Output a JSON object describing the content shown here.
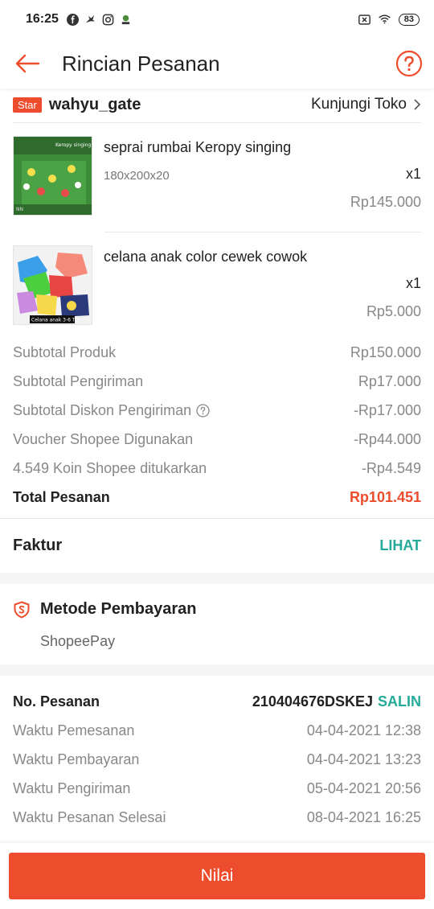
{
  "status_bar": {
    "time": "16:25",
    "battery": "83",
    "icons": [
      "facebook-icon",
      "bird-icon",
      "instagram-icon",
      "app-icon",
      "sim-icon",
      "wifi-icon",
      "battery-icon"
    ]
  },
  "header": {
    "title": "Rincian Pesanan",
    "icons": [
      "back-arrow-icon",
      "help-icon"
    ]
  },
  "shop": {
    "badge": "Star",
    "name": "wahyu_gate",
    "visit_label": "Kunjungi Toko"
  },
  "products": [
    {
      "name": "seprai rumbai Keropy singing",
      "variant": "180x200x20",
      "qty": "x1",
      "price": "Rp145.000",
      "image_text": "Keropy singing",
      "image_watermark": "NN"
    },
    {
      "name": "celana anak color cewek cowok",
      "variant": "",
      "qty": "x1",
      "price": "Rp5.000",
      "image_caption": "Celana anak 3-6 Th"
    }
  ],
  "summary": [
    {
      "label": "Subtotal Produk",
      "value": "Rp150.000"
    },
    {
      "label": "Subtotal Pengiriman",
      "value": "Rp17.000"
    },
    {
      "label": "Subtotal Diskon Pengiriman",
      "value": "-Rp17.000"
    },
    {
      "label": "Voucher Shopee Digunakan",
      "value": "-Rp44.000"
    },
    {
      "label": "4.549 Koin Shopee ditukarkan",
      "value": "-Rp4.549"
    }
  ],
  "total": {
    "label": "Total Pesanan",
    "value": "Rp101.451"
  },
  "invoice": {
    "label": "Faktur",
    "action": "LIHAT"
  },
  "payment": {
    "title": "Metode Pembayaran",
    "method": "ShopeePay"
  },
  "order_info": {
    "order_no_label": "No. Pesanan",
    "order_no": "210404676DSKEJ",
    "copy_label": "SALIN",
    "rows": [
      {
        "label": "Waktu Pemesanan",
        "value": "04-04-2021 12:38"
      },
      {
        "label": "Waktu Pembayaran",
        "value": "04-04-2021 13:23"
      },
      {
        "label": "Waktu Pengiriman",
        "value": "05-04-2021 20:56"
      },
      {
        "label": "Waktu Pesanan Selesai",
        "value": "08-04-2021 16:25"
      }
    ]
  },
  "action": {
    "rate_label": "Nilai"
  },
  "colors": {
    "accent": "#ee4d2d",
    "teal": "#26aa99"
  }
}
